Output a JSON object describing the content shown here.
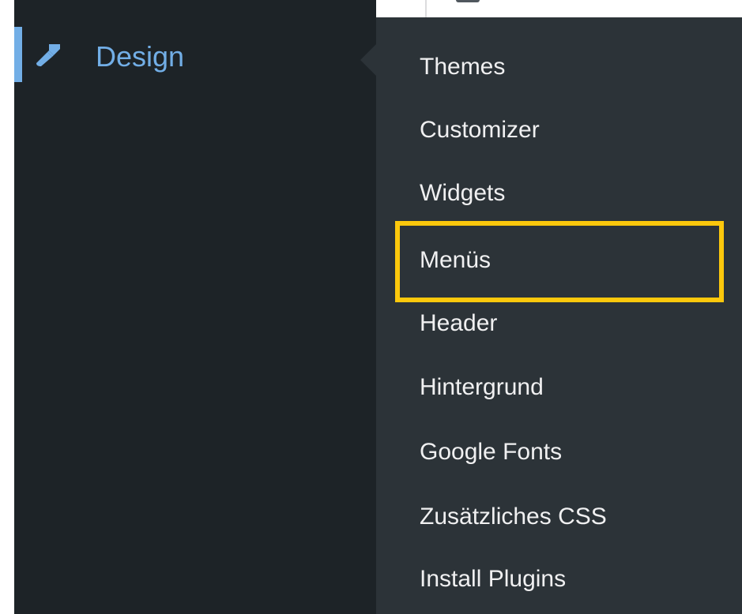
{
  "sidebar": {
    "active_item": {
      "label": "Design",
      "icon": "paintbrush-icon",
      "color": "#72aee6"
    }
  },
  "submenu": {
    "items": [
      {
        "label": "Themes"
      },
      {
        "label": "Customizer"
      },
      {
        "label": "Widgets"
      },
      {
        "label": "Menüs",
        "highlighted": true
      },
      {
        "label": "Header"
      },
      {
        "label": "Hintergrund"
      },
      {
        "label": "Google Fonts"
      },
      {
        "label": "Zusätzliches CSS"
      },
      {
        "label": "Install Plugins"
      }
    ]
  },
  "colors": {
    "sidebar_bg": "#1d2327",
    "submenu_bg": "#2c3338",
    "highlight": "#fcc80c",
    "text": "#f0f0f1",
    "accent": "#72aee6"
  }
}
